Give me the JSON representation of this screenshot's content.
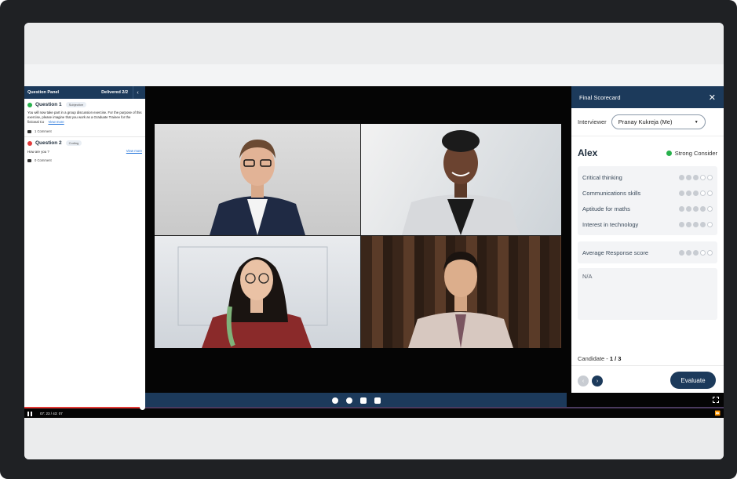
{
  "question_panel": {
    "title": "Question Panel",
    "delivered": "Delivered 2/2",
    "collapse_glyph": "‹",
    "questions": [
      {
        "title": "Question 1",
        "tag": "Subjective",
        "status_color": "#28b14c",
        "text": "You will now take part in a group discussion exercise. For the purpose of this exercise, please imagine that you work as a Graduate Trainee for the fictional Co",
        "view_more": "View more",
        "comments": "1 Comment"
      },
      {
        "title": "Question 2",
        "tag": "Coding",
        "status_color": "#e23b3b",
        "text": "How are you ?",
        "view_more": "View more",
        "comments": "0 Comment"
      }
    ]
  },
  "player": {
    "time": "07: 23 / 43: 07",
    "progress_fraction": 0.168,
    "ff_glyph": "⏩"
  },
  "scorecard": {
    "title": "Final Scorecard",
    "close_glyph": "✕",
    "interviewer_label": "Interviewer",
    "interviewer_value": "Pranay Kukreja (Me)",
    "candidate_name": "Alex",
    "recommendation": "Strong Consider",
    "recommendation_color": "#28b14c",
    "criteria": [
      {
        "label": "Critical thinking",
        "score": 3,
        "max": 5
      },
      {
        "label": "Communications skills",
        "score": 3,
        "max": 5
      },
      {
        "label": "Aptitude for maths",
        "score": 4,
        "max": 5
      },
      {
        "label": "Interest in technology",
        "score": 4,
        "max": 5
      }
    ],
    "average": {
      "label": "Average Response score",
      "score": 3,
      "max": 5
    },
    "notes": "N/A",
    "candidate_label": "Candidate - ",
    "candidate_index": "1 / 3",
    "evaluate_label": "Evaluate",
    "prev_glyph": "‹",
    "next_glyph": "›"
  },
  "colors": {
    "brand_navy": "#1c3a5b",
    "progress_red": "#e53935"
  }
}
